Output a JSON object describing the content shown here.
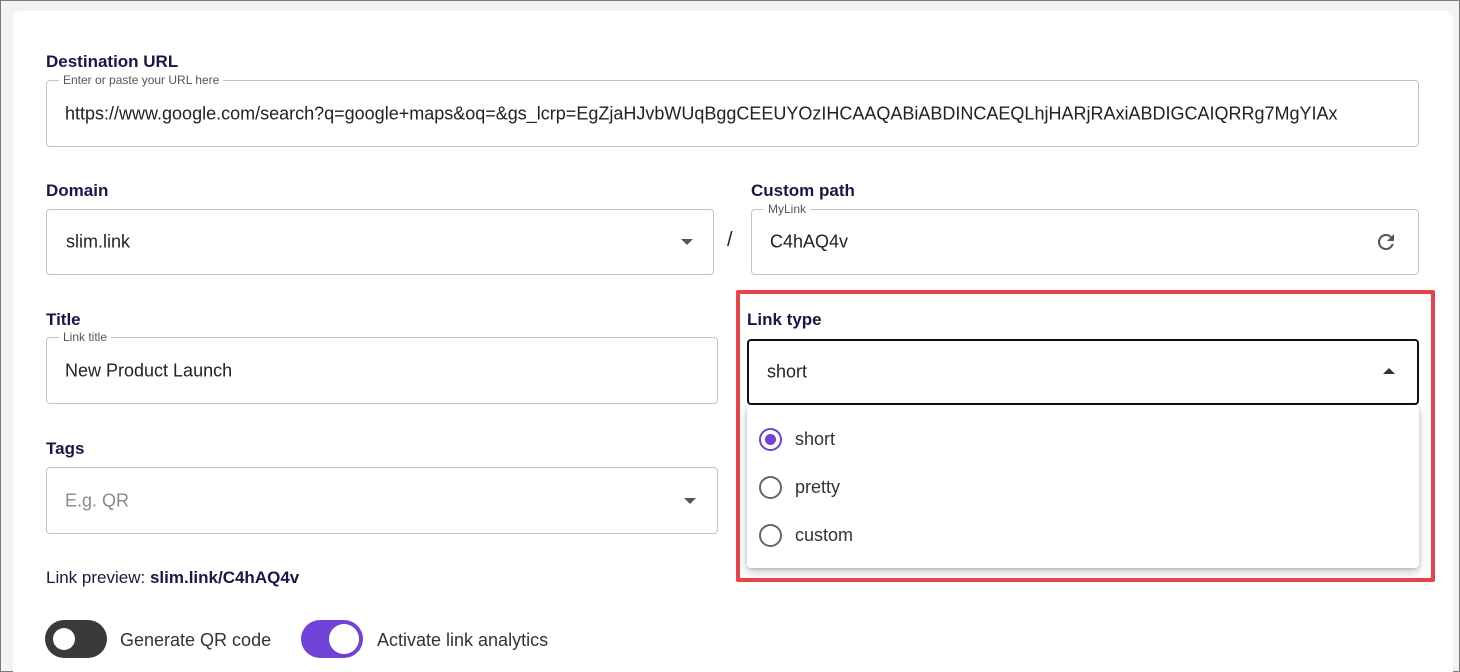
{
  "destination": {
    "label": "Destination URL",
    "legend": "Enter or paste your URL here",
    "value": "https://www.google.com/search?q=google+maps&oq=&gs_lcrp=EgZjaHJvbWUqBggCEEUYOzIHCAAQABiABDINCAEQLhjHARjRAxiABDIGCAIQRRg7MgYIAx"
  },
  "domain": {
    "label": "Domain",
    "value": "slim.link"
  },
  "separator": "/",
  "custom_path": {
    "label": "Custom path",
    "legend": "MyLink",
    "value": "C4hAQ4v"
  },
  "title": {
    "label": "Title",
    "legend": "Link title",
    "value": "New Product Launch"
  },
  "link_type": {
    "label": "Link type",
    "value": "short",
    "options": [
      {
        "label": "short",
        "selected": true
      },
      {
        "label": "pretty",
        "selected": false
      },
      {
        "label": "custom",
        "selected": false
      }
    ]
  },
  "tags": {
    "label": "Tags",
    "placeholder": "E.g. QR"
  },
  "preview": {
    "prefix": "Link preview:",
    "link": "slim.link/C4hAQ4v"
  },
  "toggles": {
    "qr": {
      "label": "Generate QR code",
      "on": false
    },
    "analytics": {
      "label": "Activate link analytics",
      "on": true
    }
  },
  "colors": {
    "accent": "#7042d8",
    "label": "#1c1648",
    "highlight": "#e8424a",
    "toggle_off": "#3a3a3a"
  }
}
